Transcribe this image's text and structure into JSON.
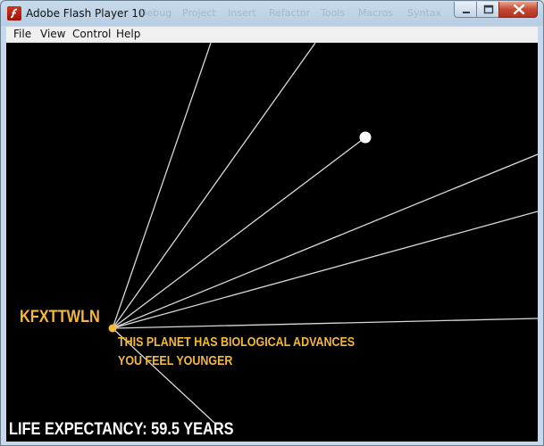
{
  "window": {
    "title": "Adobe Flash Player 10",
    "background_menu_ghost": [
      "Debug",
      "Project",
      "Insert",
      "Refactor",
      "Tools",
      "Macros",
      "Syntax"
    ]
  },
  "menu": {
    "file": "File",
    "view": "View",
    "control": "Control",
    "help": "Help"
  },
  "game": {
    "planet_name": "KFXTTWLN",
    "message_line1": "THIS PLANET HAS BIOLOGICAL ADVANCES",
    "message_line2": "YOU FEEL YOUNGER",
    "life_expectancy": "LIFE EXPECTANCY: 59.5 YEARS"
  },
  "colors": {
    "stage_background": "#000000",
    "accent_text": "#f4b83a",
    "planet_node": "#f4b83a",
    "target_dot": "#ffffff",
    "route_lines": "#d9d9d9"
  }
}
